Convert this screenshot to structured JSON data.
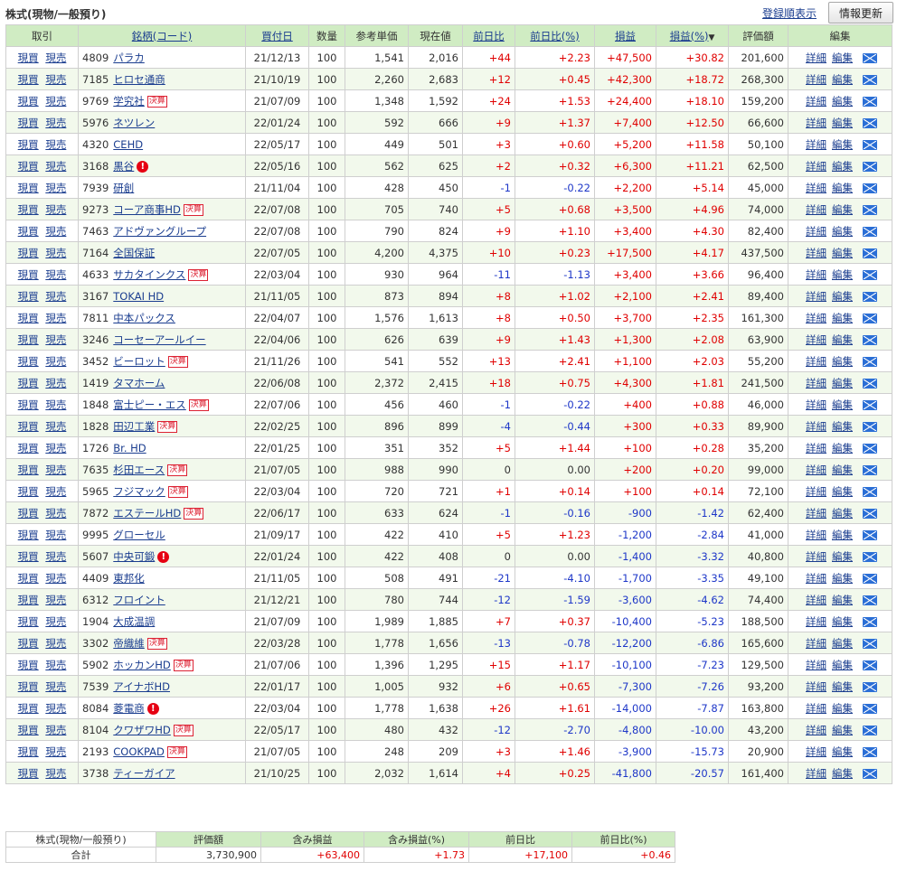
{
  "header": {
    "title": "株式(現物/一般預り)",
    "sort_link": "登録順表示",
    "refresh": "情報更新"
  },
  "columns": [
    "取引",
    "銘柄(コード)",
    "買付日",
    "数量",
    "参考単価",
    "現在値",
    "前日比",
    "前日比(%)",
    "損益",
    "損益(%)",
    "評価額",
    "編集"
  ],
  "sort_marker": "▼",
  "labels": {
    "buy": "現買",
    "sell": "現売",
    "detail": "詳細",
    "edit": "編集",
    "kessan": "決算",
    "alert_icon": "!"
  },
  "rows": [
    {
      "code": "4809",
      "name": "パラカ",
      "badge": "",
      "date": "21/12/13",
      "qty": "100",
      "ref": "1,541",
      "cur": "2,016",
      "chg": "+44",
      "chgp": "+2.23",
      "pl": "+47,500",
      "plp": "+30.82",
      "val": "201,600"
    },
    {
      "code": "7185",
      "name": "ヒロセ通商",
      "badge": "",
      "date": "21/10/19",
      "qty": "100",
      "ref": "2,260",
      "cur": "2,683",
      "chg": "+12",
      "chgp": "+0.45",
      "pl": "+42,300",
      "plp": "+18.72",
      "val": "268,300"
    },
    {
      "code": "9769",
      "name": "学究社",
      "badge": "kessan",
      "date": "21/07/09",
      "qty": "100",
      "ref": "1,348",
      "cur": "1,592",
      "chg": "+24",
      "chgp": "+1.53",
      "pl": "+24,400",
      "plp": "+18.10",
      "val": "159,200"
    },
    {
      "code": "5976",
      "name": "ネツレン",
      "badge": "",
      "date": "22/01/24",
      "qty": "100",
      "ref": "592",
      "cur": "666",
      "chg": "+9",
      "chgp": "+1.37",
      "pl": "+7,400",
      "plp": "+12.50",
      "val": "66,600"
    },
    {
      "code": "4320",
      "name": "CEHD",
      "badge": "",
      "date": "22/05/17",
      "qty": "100",
      "ref": "449",
      "cur": "501",
      "chg": "+3",
      "chgp": "+0.60",
      "pl": "+5,200",
      "plp": "+11.58",
      "val": "50,100"
    },
    {
      "code": "3168",
      "name": "黒谷",
      "badge": "alert",
      "date": "22/05/16",
      "qty": "100",
      "ref": "562",
      "cur": "625",
      "chg": "+2",
      "chgp": "+0.32",
      "pl": "+6,300",
      "plp": "+11.21",
      "val": "62,500"
    },
    {
      "code": "7939",
      "name": "研創",
      "badge": "",
      "date": "21/11/04",
      "qty": "100",
      "ref": "428",
      "cur": "450",
      "chg": "-1",
      "chgp": "-0.22",
      "pl": "+2,200",
      "plp": "+5.14",
      "val": "45,000"
    },
    {
      "code": "9273",
      "name": "コーア商事HD",
      "badge": "kessan",
      "date": "22/07/08",
      "qty": "100",
      "ref": "705",
      "cur": "740",
      "chg": "+5",
      "chgp": "+0.68",
      "pl": "+3,500",
      "plp": "+4.96",
      "val": "74,000"
    },
    {
      "code": "7463",
      "name": "アドヴァングループ",
      "badge": "",
      "date": "22/07/08",
      "qty": "100",
      "ref": "790",
      "cur": "824",
      "chg": "+9",
      "chgp": "+1.10",
      "pl": "+3,400",
      "plp": "+4.30",
      "val": "82,400"
    },
    {
      "code": "7164",
      "name": "全国保証",
      "badge": "",
      "date": "22/07/05",
      "qty": "100",
      "ref": "4,200",
      "cur": "4,375",
      "chg": "+10",
      "chgp": "+0.23",
      "pl": "+17,500",
      "plp": "+4.17",
      "val": "437,500"
    },
    {
      "code": "4633",
      "name": "サカタインクス",
      "badge": "kessan",
      "date": "22/03/04",
      "qty": "100",
      "ref": "930",
      "cur": "964",
      "chg": "-11",
      "chgp": "-1.13",
      "pl": "+3,400",
      "plp": "+3.66",
      "val": "96,400"
    },
    {
      "code": "3167",
      "name": "TOKAI HD",
      "badge": "",
      "date": "21/11/05",
      "qty": "100",
      "ref": "873",
      "cur": "894",
      "chg": "+8",
      "chgp": "+1.02",
      "pl": "+2,100",
      "plp": "+2.41",
      "val": "89,400"
    },
    {
      "code": "7811",
      "name": "中本パックス",
      "badge": "",
      "date": "22/04/07",
      "qty": "100",
      "ref": "1,576",
      "cur": "1,613",
      "chg": "+8",
      "chgp": "+0.50",
      "pl": "+3,700",
      "plp": "+2.35",
      "val": "161,300"
    },
    {
      "code": "3246",
      "name": "コーセーアールイー",
      "badge": "",
      "date": "22/04/06",
      "qty": "100",
      "ref": "626",
      "cur": "639",
      "chg": "+9",
      "chgp": "+1.43",
      "pl": "+1,300",
      "plp": "+2.08",
      "val": "63,900"
    },
    {
      "code": "3452",
      "name": "ビーロット",
      "badge": "kessan",
      "date": "21/11/26",
      "qty": "100",
      "ref": "541",
      "cur": "552",
      "chg": "+13",
      "chgp": "+2.41",
      "pl": "+1,100",
      "plp": "+2.03",
      "val": "55,200"
    },
    {
      "code": "1419",
      "name": "タマホーム",
      "badge": "",
      "date": "22/06/08",
      "qty": "100",
      "ref": "2,372",
      "cur": "2,415",
      "chg": "+18",
      "chgp": "+0.75",
      "pl": "+4,300",
      "plp": "+1.81",
      "val": "241,500"
    },
    {
      "code": "1848",
      "name": "富士ピー・エス",
      "badge": "kessan",
      "date": "22/07/06",
      "qty": "100",
      "ref": "456",
      "cur": "460",
      "chg": "-1",
      "chgp": "-0.22",
      "pl": "+400",
      "plp": "+0.88",
      "val": "46,000"
    },
    {
      "code": "1828",
      "name": "田辺工業",
      "badge": "kessan",
      "date": "22/02/25",
      "qty": "100",
      "ref": "896",
      "cur": "899",
      "chg": "-4",
      "chgp": "-0.44",
      "pl": "+300",
      "plp": "+0.33",
      "val": "89,900"
    },
    {
      "code": "1726",
      "name": "Br. HD",
      "badge": "",
      "date": "22/01/25",
      "qty": "100",
      "ref": "351",
      "cur": "352",
      "chg": "+5",
      "chgp": "+1.44",
      "pl": "+100",
      "plp": "+0.28",
      "val": "35,200"
    },
    {
      "code": "7635",
      "name": "杉田エース",
      "badge": "kessan",
      "date": "21/07/05",
      "qty": "100",
      "ref": "988",
      "cur": "990",
      "chg": "0",
      "chgp": "0.00",
      "pl": "+200",
      "plp": "+0.20",
      "val": "99,000"
    },
    {
      "code": "5965",
      "name": "フジマック",
      "badge": "kessan",
      "date": "22/03/04",
      "qty": "100",
      "ref": "720",
      "cur": "721",
      "chg": "+1",
      "chgp": "+0.14",
      "pl": "+100",
      "plp": "+0.14",
      "val": "72,100"
    },
    {
      "code": "7872",
      "name": "エステールHD",
      "badge": "kessan",
      "date": "22/06/17",
      "qty": "100",
      "ref": "633",
      "cur": "624",
      "chg": "-1",
      "chgp": "-0.16",
      "pl": "-900",
      "plp": "-1.42",
      "val": "62,400"
    },
    {
      "code": "9995",
      "name": "グローセル",
      "badge": "",
      "date": "21/09/17",
      "qty": "100",
      "ref": "422",
      "cur": "410",
      "chg": "+5",
      "chgp": "+1.23",
      "pl": "-1,200",
      "plp": "-2.84",
      "val": "41,000"
    },
    {
      "code": "5607",
      "name": "中央可鍛",
      "badge": "alert",
      "date": "22/01/24",
      "qty": "100",
      "ref": "422",
      "cur": "408",
      "chg": "0",
      "chgp": "0.00",
      "pl": "-1,400",
      "plp": "-3.32",
      "val": "40,800"
    },
    {
      "code": "4409",
      "name": "東邦化",
      "badge": "",
      "date": "21/11/05",
      "qty": "100",
      "ref": "508",
      "cur": "491",
      "chg": "-21",
      "chgp": "-4.10",
      "pl": "-1,700",
      "plp": "-3.35",
      "val": "49,100"
    },
    {
      "code": "6312",
      "name": "フロイント",
      "badge": "",
      "date": "21/12/21",
      "qty": "100",
      "ref": "780",
      "cur": "744",
      "chg": "-12",
      "chgp": "-1.59",
      "pl": "-3,600",
      "plp": "-4.62",
      "val": "74,400"
    },
    {
      "code": "1904",
      "name": "大成温調",
      "badge": "",
      "date": "21/07/09",
      "qty": "100",
      "ref": "1,989",
      "cur": "1,885",
      "chg": "+7",
      "chgp": "+0.37",
      "pl": "-10,400",
      "plp": "-5.23",
      "val": "188,500"
    },
    {
      "code": "3302",
      "name": "帝織維",
      "badge": "kessan",
      "date": "22/03/28",
      "qty": "100",
      "ref": "1,778",
      "cur": "1,656",
      "chg": "-13",
      "chgp": "-0.78",
      "pl": "-12,200",
      "plp": "-6.86",
      "val": "165,600"
    },
    {
      "code": "5902",
      "name": "ホッカンHD",
      "badge": "kessan",
      "date": "21/07/06",
      "qty": "100",
      "ref": "1,396",
      "cur": "1,295",
      "chg": "+15",
      "chgp": "+1.17",
      "pl": "-10,100",
      "plp": "-7.23",
      "val": "129,500"
    },
    {
      "code": "7539",
      "name": "アイナボHD",
      "badge": "",
      "date": "22/01/17",
      "qty": "100",
      "ref": "1,005",
      "cur": "932",
      "chg": "+6",
      "chgp": "+0.65",
      "pl": "-7,300",
      "plp": "-7.26",
      "val": "93,200"
    },
    {
      "code": "8084",
      "name": "菱電商",
      "badge": "alert",
      "date": "22/03/04",
      "qty": "100",
      "ref": "1,778",
      "cur": "1,638",
      "chg": "+26",
      "chgp": "+1.61",
      "pl": "-14,000",
      "plp": "-7.87",
      "val": "163,800"
    },
    {
      "code": "8104",
      "name": "クワザワHD",
      "badge": "kessan",
      "date": "22/05/17",
      "qty": "100",
      "ref": "480",
      "cur": "432",
      "chg": "-12",
      "chgp": "-2.70",
      "pl": "-4,800",
      "plp": "-10.00",
      "val": "43,200"
    },
    {
      "code": "2193",
      "name": "COOKPAD",
      "badge": "kessan",
      "date": "21/07/05",
      "qty": "100",
      "ref": "248",
      "cur": "209",
      "chg": "+3",
      "chgp": "+1.46",
      "pl": "-3,900",
      "plp": "-15.73",
      "val": "20,900"
    },
    {
      "code": "3738",
      "name": "ティーガイア",
      "badge": "",
      "date": "21/10/25",
      "qty": "100",
      "ref": "2,032",
      "cur": "1,614",
      "chg": "+4",
      "chgp": "+0.25",
      "pl": "-41,800",
      "plp": "-20.57",
      "val": "161,400"
    }
  ],
  "summary": {
    "label_top": "株式(現物/一般預り)",
    "label_bottom": "合計",
    "columns": [
      "評価額",
      "含み損益",
      "含み損益(%)",
      "前日比",
      "前日比(%)"
    ],
    "values": [
      "3,730,900",
      "+63,400",
      "+1.73",
      "+17,100",
      "+0.46"
    ]
  },
  "colors": {
    "header_bg": "#d0ecc3",
    "row_alt": "#f2f9ec",
    "positive": "#e00000",
    "negative": "#1e37c8",
    "link": "#1a3d8f",
    "mail_icon": "#2b6fd6"
  }
}
